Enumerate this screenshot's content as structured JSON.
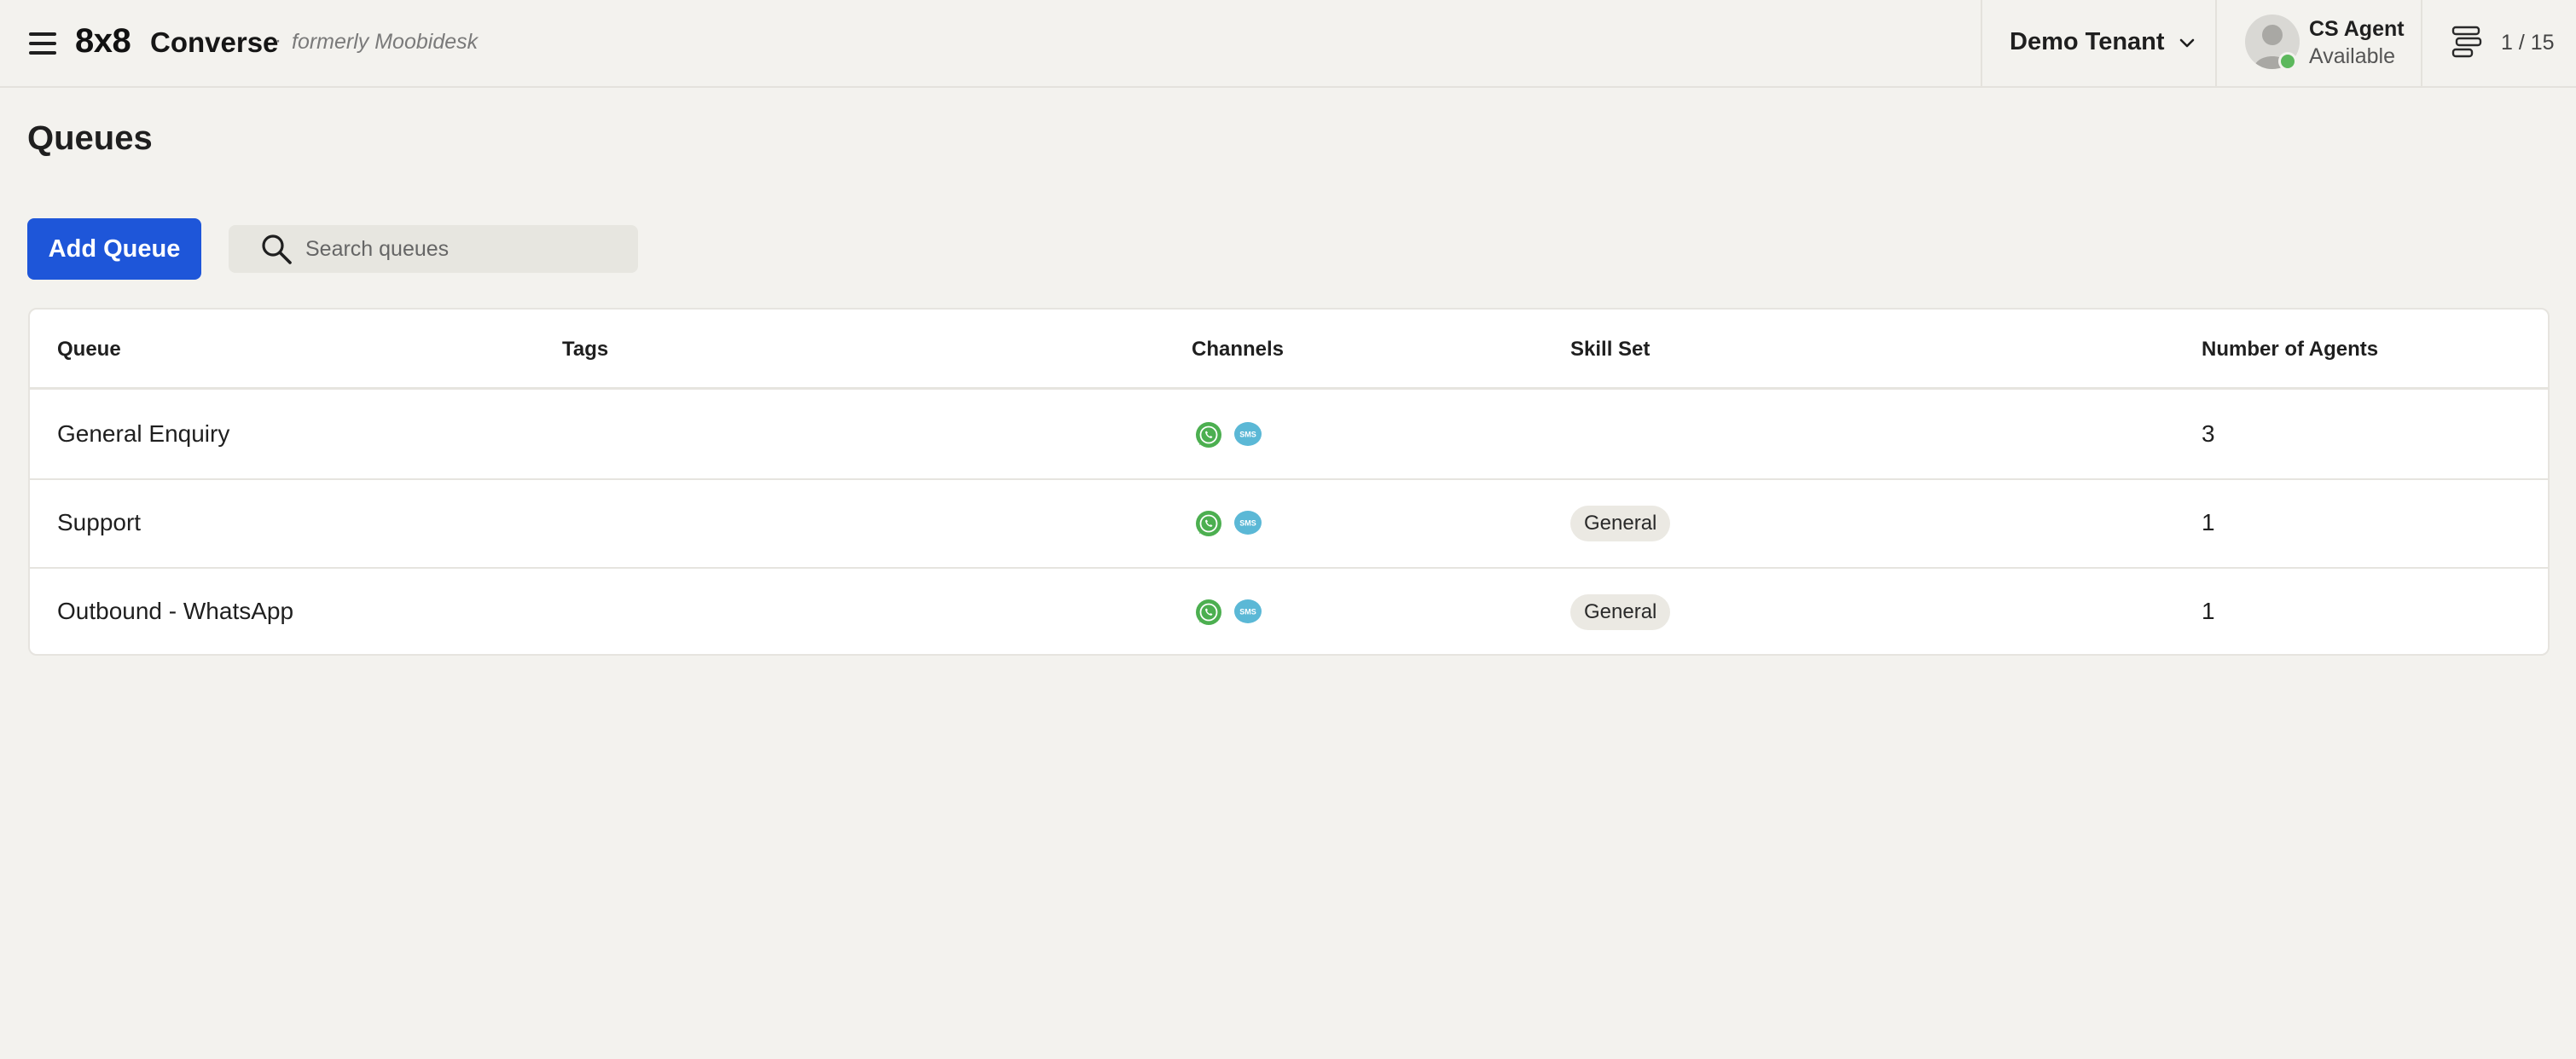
{
  "header": {
    "brand_primary": "8x8",
    "brand_product": "Converse",
    "brand_separator": "·",
    "brand_formerly": "formerly Moobidesk",
    "tenant": "Demo Tenant",
    "agent_name": "CS Agent",
    "agent_status": "Available",
    "conversation_counter": "1 / 15"
  },
  "page": {
    "title": "Queues",
    "add_button": "Add Queue",
    "search_placeholder": "Search queues"
  },
  "table": {
    "columns": [
      "Queue",
      "Tags",
      "Channels",
      "Skill Set",
      "Number of Agents"
    ],
    "rows": [
      {
        "queue": "General Enquiry",
        "tags": "",
        "channels": [
          "whatsapp-icon",
          "sms-icon"
        ],
        "skill_set": "",
        "agents": "3"
      },
      {
        "queue": "Support",
        "tags": "",
        "channels": [
          "whatsapp-icon",
          "sms-icon"
        ],
        "skill_set": "General",
        "agents": "1"
      },
      {
        "queue": "Outbound - WhatsApp",
        "tags": "",
        "channels": [
          "whatsapp-icon",
          "sms-icon"
        ],
        "skill_set": "General",
        "agents": "1"
      }
    ]
  },
  "colors": {
    "primary_button": "#1e56d9",
    "status_available": "#5cb85c",
    "whatsapp": "#4caf50",
    "sms": "#5bb8d6",
    "background": "#f3f2ee"
  }
}
